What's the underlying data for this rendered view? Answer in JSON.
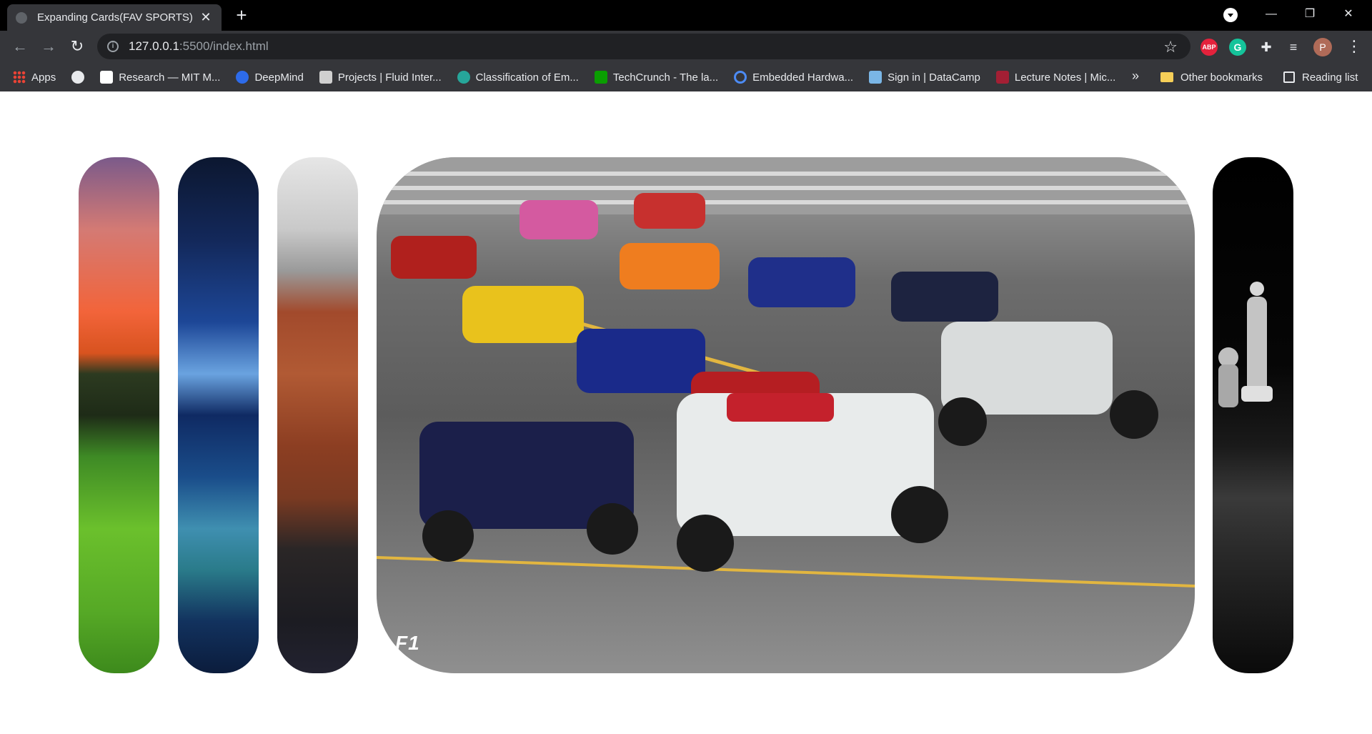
{
  "browser": {
    "tab_title": "Expanding Cards(FAV SPORTS)",
    "url_host": "127.0.0.1",
    "url_path": ":5500/index.html",
    "extensions": {
      "abp": "ABP",
      "grammarly": "G",
      "profile_initial": "P"
    }
  },
  "bookmarks": {
    "items": [
      {
        "label": "Apps"
      },
      {
        "label": "Research — MIT M..."
      },
      {
        "label": "DeepMind"
      },
      {
        "label": "Projects | Fluid Inter..."
      },
      {
        "label": "Classification of Em..."
      },
      {
        "label": "TechCrunch - The la..."
      },
      {
        "label": "Embedded Hardwa..."
      },
      {
        "label": "Sign in | DataCamp"
      },
      {
        "label": "Lecture Notes | Mic..."
      }
    ],
    "more": "»",
    "other": "Other bookmarks",
    "reading_list": "Reading list"
  },
  "cards": {
    "active_title": "F1"
  },
  "colors": {
    "titlebar": "#000000",
    "toolbar": "#35363a",
    "omnibox": "#202124",
    "page_background": "#ffffff"
  }
}
